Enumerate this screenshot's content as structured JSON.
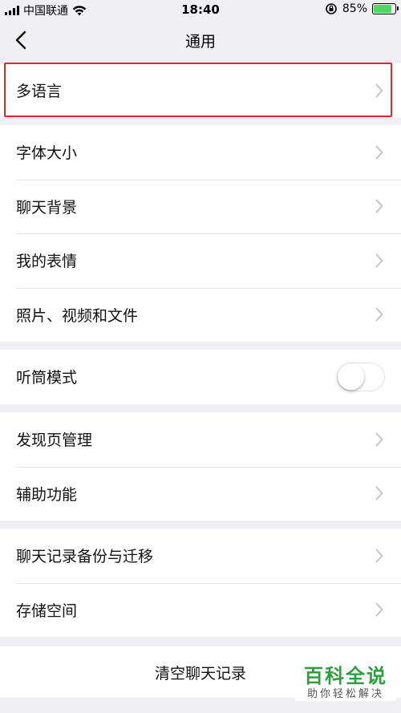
{
  "status_bar": {
    "carrier": "中国联通",
    "time": "18:40",
    "battery_percent": "85%",
    "battery_level": 0.85
  },
  "nav": {
    "title": "通用"
  },
  "groups": {
    "language": [
      "多语言"
    ],
    "display": [
      "字体大小",
      "聊天背景",
      "我的表情",
      "照片、视频和文件"
    ],
    "receiver": {
      "label": "听筒模式",
      "enabled": false
    },
    "features": [
      "发现页管理",
      "辅助功能"
    ],
    "storage": [
      "聊天记录备份与迁移",
      "存储空间"
    ]
  },
  "clear_button": "清空聊天记录",
  "watermark": {
    "title": "百科全说",
    "subtitle": "助你轻松解决"
  },
  "colors": {
    "highlight_border": "#e0282e",
    "battery_fill": "#4cd964",
    "watermark_green": "#2e9e3e"
  }
}
